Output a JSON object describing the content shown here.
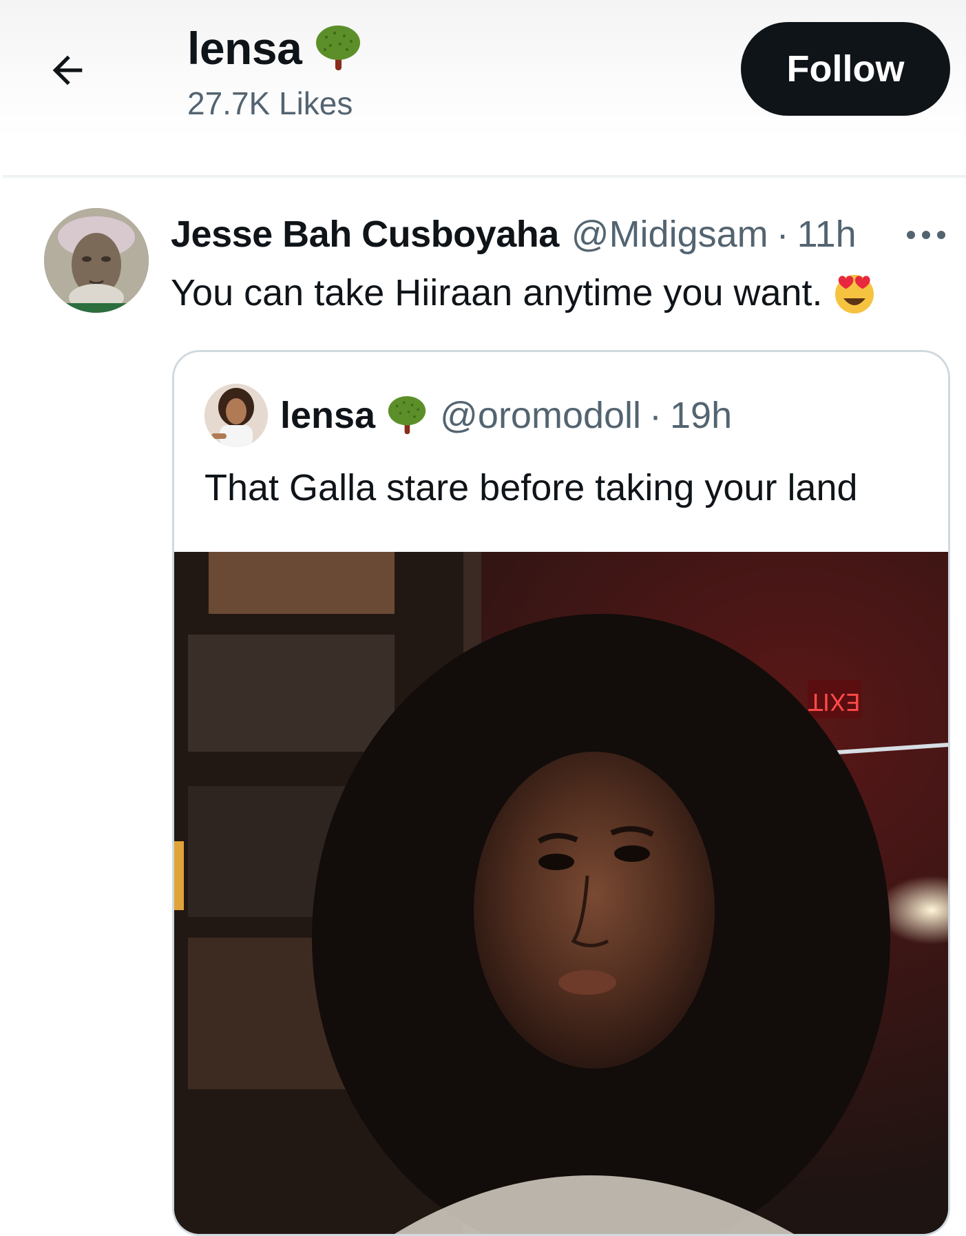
{
  "header": {
    "title": "lensa",
    "likes": "27.7K Likes",
    "follow_label": "Follow",
    "back_icon": "arrow-left-icon",
    "badge_icon": "tree-icon"
  },
  "tweet": {
    "author_name": "Jesse Bah Cusboyaha",
    "author_handle": "@Midigsam",
    "separator": "·",
    "time": "11h",
    "text": "You can take Hiiraan anytime you want.",
    "emoji_icon": "heart-eyes-emoji-icon",
    "more_icon": "more-icon"
  },
  "quote": {
    "author_name": "lensa",
    "author_handle": "@oromodoll",
    "separator": "·",
    "time": "19h",
    "text": "That Galla stare before taking your land",
    "badge_icon": "tree-icon",
    "media_sign": "EXIT"
  },
  "colors": {
    "text_primary": "#0f1419",
    "text_secondary": "#536471",
    "follow_bg": "#0f1419",
    "border": "#cfd9de",
    "tree_green": "#5c8f2a",
    "tree_trunk": "#8a2b1b"
  }
}
